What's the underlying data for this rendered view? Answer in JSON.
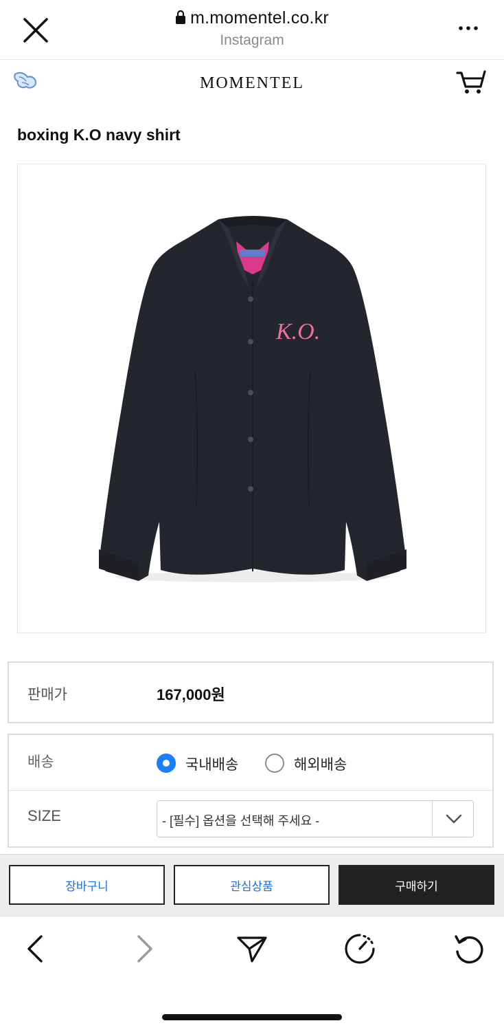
{
  "browser": {
    "url": "m.momentel.co.kr",
    "subtitle": "Instagram"
  },
  "site": {
    "logo": "MOMENTEL"
  },
  "product": {
    "title": "boxing K.O navy shirt",
    "print_text": "K.O."
  },
  "price": {
    "label": "판매가",
    "value": "167,000원"
  },
  "shipping": {
    "label": "배송",
    "options": [
      "국내배송",
      "해외배송"
    ],
    "selected": "국내배송"
  },
  "size": {
    "label": "SIZE",
    "placeholder": "- [필수] 옵션을 선택해 주세요 -"
  },
  "actions": {
    "cart": "장바구니",
    "wishlist": "관심상품",
    "buy": "구매하기"
  },
  "colors": {
    "accent": "#1a7fff",
    "shirt": "#23262d",
    "print": "#ef6f9a",
    "buy_button": "#222222"
  }
}
